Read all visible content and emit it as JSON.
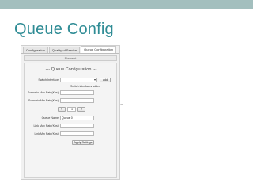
{
  "slide": {
    "title": "Queue Config"
  },
  "window": {
    "tabs": [
      {
        "label": "Configuration"
      },
      {
        "label": "Quality of Service"
      },
      {
        "label": "Queue Configuration"
      }
    ],
    "toolbar_label": "Element",
    "section_title": "--- Queue Configuration ---",
    "switch_interface_label": "Switch Interface",
    "switch_interface_value": "",
    "add_label": "add",
    "switch_added_note": "Switch interfaces added",
    "scenario_max_rate_label": "Scenario Max Rate(Kbs)",
    "scenario_min_rate_label": "Scenario Min Rate(Kbs)",
    "queue_prev_label": "<",
    "queue_index": "1",
    "queue_next_label": ">",
    "queue_name_label": "Queue Name",
    "queue_name_value": "Queue 0",
    "link_max_rate_label": "Link Max Rate(Kbs)",
    "link_min_rate_label": "Link Min Rate(Kbs)",
    "apply_label": "Apply Settings"
  },
  "colors": {
    "title": "#2f8c95",
    "top_rule": "#a3bfbe"
  }
}
